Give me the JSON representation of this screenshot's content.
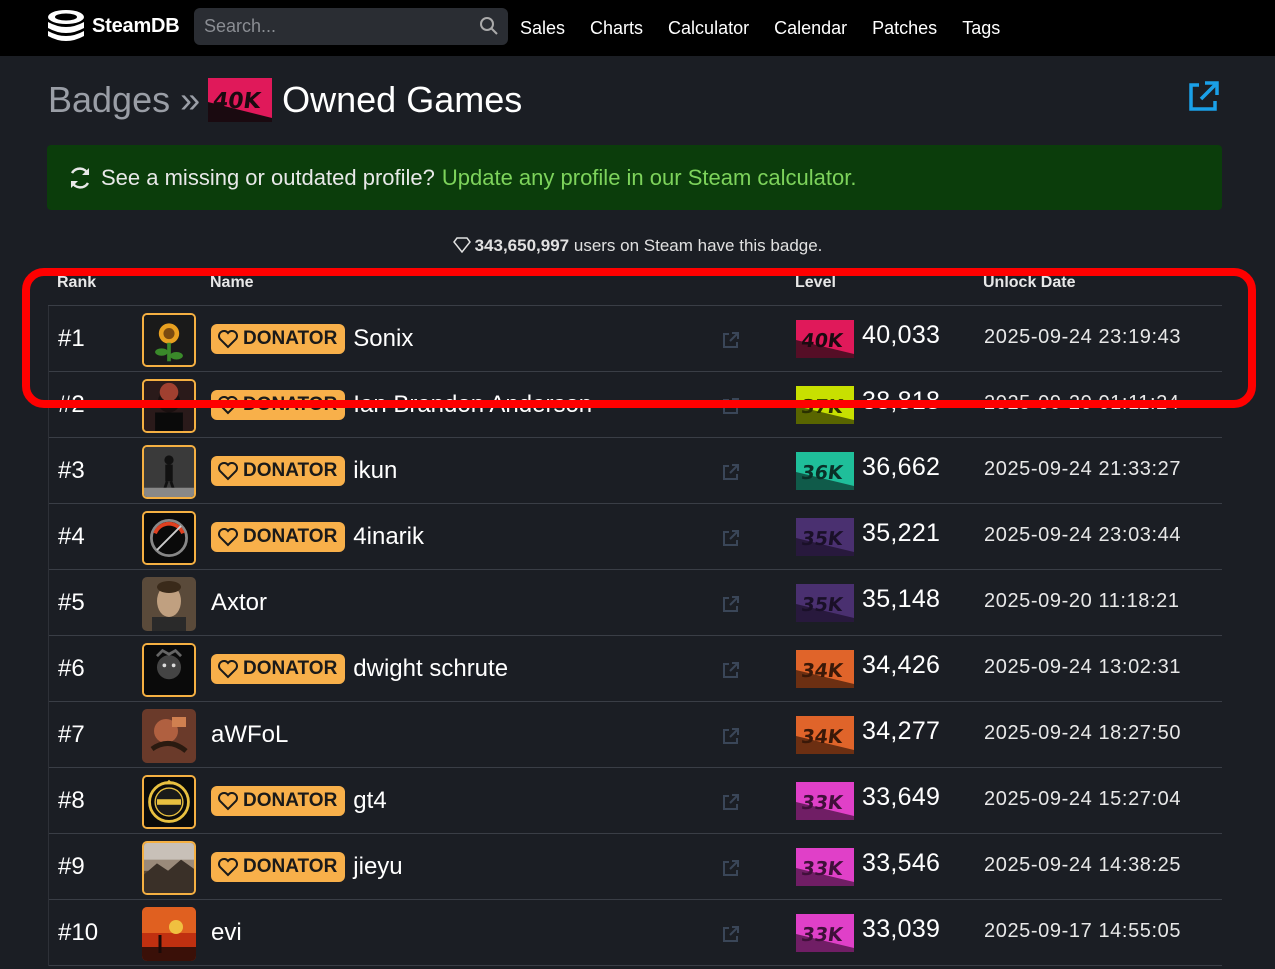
{
  "nav": {
    "brand": "SteamDB",
    "search_placeholder": "Search...",
    "links": [
      "Sales",
      "Charts",
      "Calculator",
      "Calendar",
      "Patches",
      "Tags"
    ]
  },
  "header": {
    "breadcrumb": "Badges",
    "separator": "»",
    "badge_text": "40K",
    "title": "Owned Games"
  },
  "alert": {
    "text": "See a missing or outdated profile?",
    "link": "Update any profile in our Steam calculator."
  },
  "stat": {
    "count": "343,650,997",
    "text": "users on Steam have this badge."
  },
  "table": {
    "columns": [
      "Rank",
      "Name",
      "Level",
      "Unlock Date"
    ],
    "donator_label": "DONATOR",
    "rows": [
      {
        "rank": "#1",
        "name": "Sonix",
        "donator": true,
        "badge": "40K",
        "level": "40,033",
        "date": "2025-09-24 23:19:43"
      },
      {
        "rank": "#2",
        "name": "Ian Brandon Anderson",
        "donator": true,
        "badge": "37K",
        "level": "38,818",
        "date": "2025-09-20 01:11:24"
      },
      {
        "rank": "#3",
        "name": "ikun",
        "donator": true,
        "badge": "36K",
        "level": "36,662",
        "date": "2025-09-24 21:33:27"
      },
      {
        "rank": "#4",
        "name": "4inarik",
        "donator": true,
        "badge": "35K",
        "level": "35,221",
        "date": "2025-09-24 23:03:44"
      },
      {
        "rank": "#5",
        "name": "Axtor",
        "donator": false,
        "badge": "35K",
        "level": "35,148",
        "date": "2025-09-20 11:18:21"
      },
      {
        "rank": "#6",
        "name": "dwight schrute",
        "donator": true,
        "badge": "34K",
        "level": "34,426",
        "date": "2025-09-24 13:02:31"
      },
      {
        "rank": "#7",
        "name": "aWFoL",
        "donator": false,
        "badge": "34K",
        "level": "34,277",
        "date": "2025-09-24 18:27:50"
      },
      {
        "rank": "#8",
        "name": "gt4",
        "donator": true,
        "badge": "33K",
        "level": "33,649",
        "date": "2025-09-24 15:27:04"
      },
      {
        "rank": "#9",
        "name": "jieyu",
        "donator": true,
        "badge": "33K",
        "level": "33,546",
        "date": "2025-09-24 14:38:25"
      },
      {
        "rank": "#10",
        "name": "evi",
        "donator": false,
        "badge": "33K",
        "level": "33,039",
        "date": "2025-09-17 14:55:05"
      }
    ]
  },
  "colors": {
    "badge_40k": "#e0195a",
    "badge_37k": "#c8e000",
    "badge_36k": "#1fbf9a",
    "badge_35k": "#4a3070",
    "badge_34k": "#e0642a",
    "badge_33k": "#e040c8",
    "donator": "#f8b04a",
    "alert_link": "#7dd35b",
    "highlight": "#ff0000",
    "ext_link": "#1aa0e8"
  }
}
